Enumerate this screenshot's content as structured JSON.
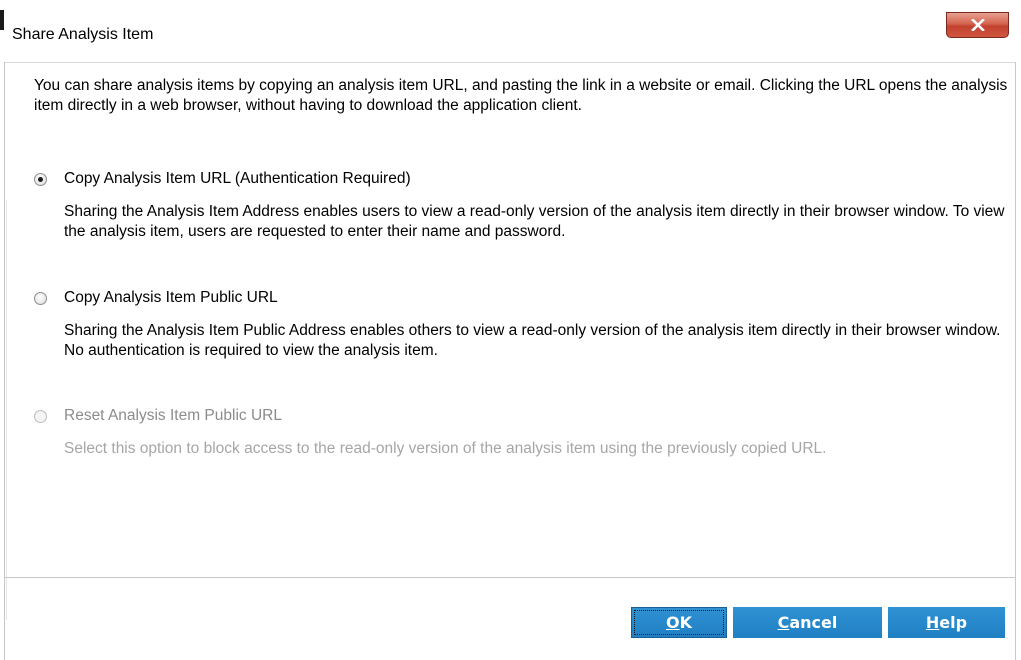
{
  "window": {
    "title": "Share Analysis Item",
    "close_icon": "close-icon"
  },
  "intro": {
    "text": "You can share analysis items by copying an analysis item URL, and pasting the link in a website or email. Clicking the URL opens the analysis item directly in a web browser, without having to download the application client."
  },
  "options": [
    {
      "label": "Copy Analysis Item URL (Authentication Required)",
      "description": "Sharing the Analysis Item Address enables users to view a read-only version of the analysis item directly in their browser window. To view the analysis item, users are requested to enter their name and password.",
      "checked": true,
      "enabled": true
    },
    {
      "label": "Copy Analysis Item Public URL",
      "description": "Sharing the Analysis Item Public Address enables others to view a read-only version of the analysis item directly in their browser window. No authentication is required to view the analysis item.",
      "checked": false,
      "enabled": true
    },
    {
      "label": "Reset Analysis Item Public URL",
      "description": "Select this option to block access to the read-only version of the analysis item using the previously copied URL.",
      "checked": false,
      "enabled": false
    }
  ],
  "buttons": {
    "ok": {
      "mnemonic": "O",
      "rest": "K"
    },
    "cancel": {
      "mnemonic": "C",
      "rest": "ancel"
    },
    "help": {
      "mnemonic": "H",
      "rest": "elp"
    }
  },
  "colors": {
    "button_blue": "#1f7fc2",
    "close_red": "#c24130",
    "disabled_text": "#a6a6a6"
  }
}
